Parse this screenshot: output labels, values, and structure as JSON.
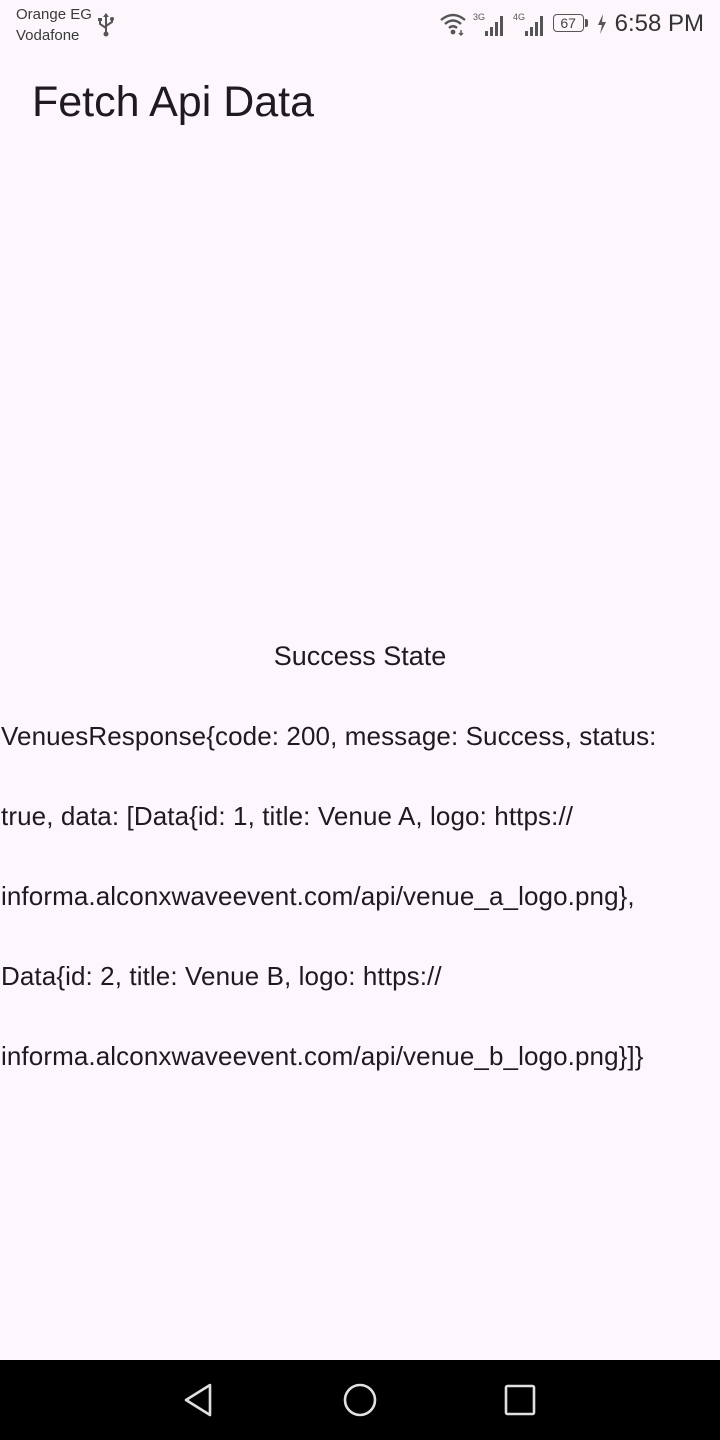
{
  "status_bar": {
    "carrier_1": "Orange EG",
    "carrier_2": "Vodafone",
    "network_1": "3G",
    "network_2": "4G",
    "battery_level": "67",
    "time": "6:58 PM"
  },
  "app_bar": {
    "title": "Fetch Api Data"
  },
  "content": {
    "state_label": "Success State",
    "response_lines": [
      "VenuesResponse{code: 200, message: Success, status:",
      "true, data: [Data{id: 1, title: Venue A, logo: https://",
      "informa.alconxwaveevent.com/api/venue_a_logo.png},",
      "Data{id: 2, title: Venue B, logo: https://",
      "informa.alconxwaveevent.com/api/venue_b_logo.png}]}"
    ]
  },
  "nav_bar": {
    "icons": [
      "back-icon",
      "home-icon",
      "recent-apps-icon"
    ]
  },
  "colors": {
    "background": "#fdf7fd",
    "text": "#1d1b20",
    "nav_bar": "#000000"
  }
}
